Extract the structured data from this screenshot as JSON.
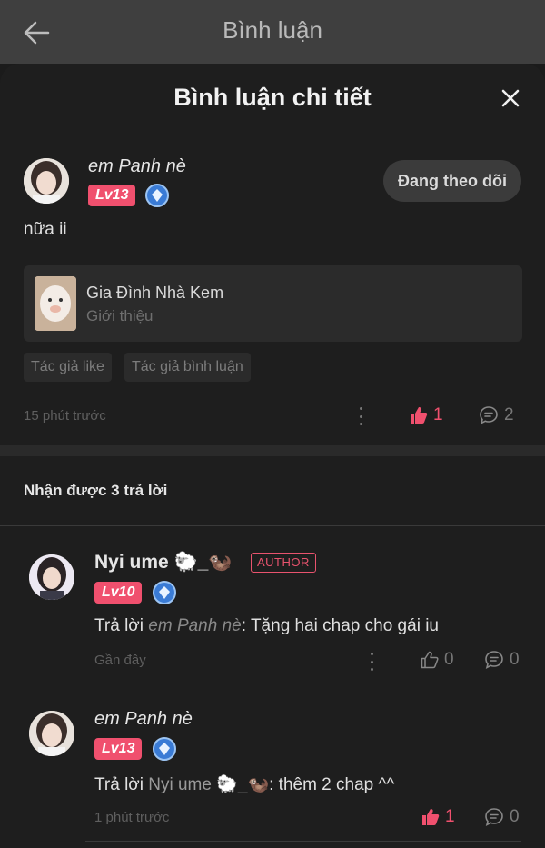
{
  "header": {
    "title": "Bình luận"
  },
  "sheet": {
    "title": "Bình luận chi tiết"
  },
  "main_comment": {
    "author": "em Panh nè",
    "level": "Lv13",
    "follow_label": "Đang theo dõi",
    "text": "nữa ii",
    "book": {
      "title": "Gia Đình Nhà Kem",
      "subtitle": "Giới thiệu"
    },
    "tags": [
      "Tác giả like",
      "Tác giả bình luận"
    ],
    "time": "15 phút trước",
    "likes": "1",
    "comments": "2"
  },
  "replies_header": "Nhận được 3 trả lời",
  "replies": [
    {
      "author": "Nyi ume 🐑_🦦",
      "author_badge": "AUTHOR",
      "level": "Lv10",
      "prefix": "Trả lời ",
      "reply_to": "em Panh nè",
      "text": ": Tặng hai chap cho gái iu",
      "time": "Gần đây",
      "likes": "0",
      "comments": "0"
    },
    {
      "author": "em Panh nè",
      "level": "Lv13",
      "prefix": "Trả lời ",
      "reply_to": "Nyi ume 🐑_🦦",
      "text": ": thêm 2 chap ^^",
      "time": "1 phút trước",
      "likes": "1",
      "comments": "0"
    }
  ],
  "colors": {
    "accent": "#f0506e",
    "background": "#1e1e1e",
    "topbar": "#3f3f3f"
  }
}
